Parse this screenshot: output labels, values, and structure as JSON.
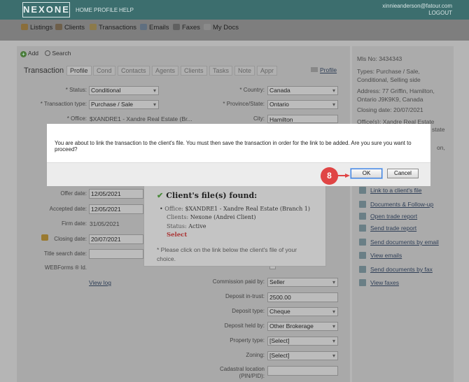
{
  "header": {
    "logo": "NEXONE",
    "nav": [
      "HOME",
      "PROFILE",
      "HELP"
    ],
    "user_email": "xinnieanderson@fatour.com",
    "logout": "LOGOUT"
  },
  "subnav": [
    {
      "label": "Listings",
      "icon": "home-icon"
    },
    {
      "label": "Clients",
      "icon": "people-icon"
    },
    {
      "label": "Transactions",
      "icon": "folder-icon"
    },
    {
      "label": "Emails",
      "icon": "envelope-icon"
    },
    {
      "label": "Faxes",
      "icon": "fax-icon"
    },
    {
      "label": "My Docs",
      "icon": "document-icon"
    }
  ],
  "toolbar": {
    "add": "Add",
    "search": "Search"
  },
  "tabs": {
    "title": "Transaction",
    "items": [
      "Profile",
      "Cond",
      "Contacts",
      "Agents",
      "Clients",
      "Tasks",
      "Note",
      "Appr"
    ],
    "profile_link": "Profile"
  },
  "form": {
    "status": {
      "label": "* Status:",
      "value": "Conditional"
    },
    "transaction_type": {
      "label": "* Transaction type:",
      "value": "Purchase / Sale"
    },
    "office": {
      "label": "* Office:",
      "value": "$XANDRE1 - Xandre Real Estate (Br..."
    },
    "country": {
      "label": "* Country:",
      "value": "Canada"
    },
    "province": {
      "label": "* Province/State:",
      "value": "Ontario"
    },
    "city": {
      "label": "City:",
      "value": "Hamilton"
    },
    "offer_date": {
      "label": "Offer date:",
      "value": "12/05/2021"
    },
    "accepted_date": {
      "label": "Accepted date:",
      "value": "12/05/2021"
    },
    "firm_date": {
      "label": "Firm date:",
      "value": "31/05/2021"
    },
    "closing_date": {
      "label": "Closing date:",
      "value": "20/07/2021"
    },
    "title_search": {
      "label": "Title search date:"
    },
    "webforms_id": {
      "label": "WEBForms ® Id."
    },
    "view_log": "View log",
    "commission_paid_by": {
      "label": "Commission paid by:",
      "value": "Seller"
    },
    "deposit_in_trust": {
      "label": "Deposit in-trust:",
      "value": "2500.00"
    },
    "deposit_type": {
      "label": "Deposit type:",
      "value": "Cheque"
    },
    "deposit_held_by": {
      "label": "Deposit held by:",
      "value": "Other Brokerage"
    },
    "property_type": {
      "label": "Property type:",
      "value": "[Select]"
    },
    "zoning": {
      "label": "Zoning:",
      "value": "[Select]"
    },
    "cadastral": {
      "label": "Cadastral location (PIN/PID):"
    }
  },
  "side": {
    "mls_label": "Mls No:",
    "mls_value": "3434343",
    "types_label": "Types:",
    "types_value": "Purchase / Sale, Conditional, Selling side",
    "address_label": "Address:",
    "address_value": "77 Griffin, Hamilton, Ontario J9K9K9, Canada",
    "closing_label": "Closing date:",
    "closing_value": "20/07/2021",
    "office_label": "Office(s):",
    "office_value": "Xandre Real Estate",
    "office_value_2": "state",
    "office_value_3": "on,",
    "links": [
      {
        "label": "Link to a client's file",
        "icon": "link-icon"
      },
      {
        "label": "Documents & Follow-up",
        "icon": "documents-icon"
      },
      {
        "label": "Open trade report",
        "icon": "report-icon"
      },
      {
        "label": "Send trade report",
        "icon": "send-report-icon"
      },
      {
        "label": "Send documents by email",
        "icon": "email-icon"
      },
      {
        "label": "View emails",
        "icon": "view-email-icon"
      },
      {
        "label": "Send documents by fax",
        "icon": "fax-icon"
      },
      {
        "label": "View faxes",
        "icon": "view-fax-icon"
      }
    ]
  },
  "found_popup": {
    "title": "Client's file(s) found:",
    "office_label": "Office:",
    "office_value": "$XANDRE1 - Xandre Real Estate (Branch 1)",
    "clients_label": "Clients:",
    "clients_value": "Nexone (Andrei Client)",
    "status_label": "Status:",
    "status_value": "Active",
    "select": "Select",
    "note": "* Please click on the link below the client's file of your choice."
  },
  "modal": {
    "message": "You are about to link the transaction to the client's file. You must then save the transaction in order for the link to be added. Are you sure you want to proceed?",
    "ok": "OK",
    "cancel": "Cancel"
  },
  "step_badge": "8",
  "colors": {
    "header": "#3c6e6e",
    "badge": "#e04545",
    "ok_focus": "#3b7bd9"
  }
}
